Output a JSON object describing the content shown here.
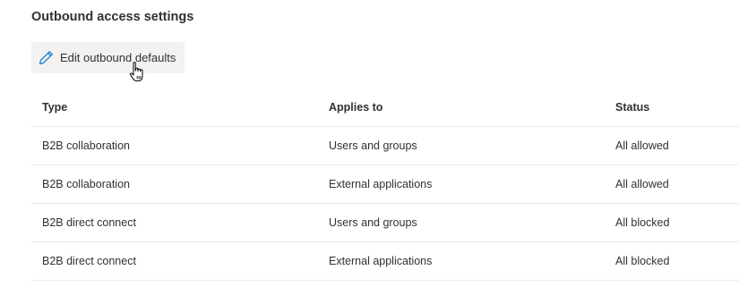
{
  "section": {
    "title": "Outbound access settings"
  },
  "toolbar": {
    "edit_label": "Edit outbound defaults",
    "edit_icon": "pencil-icon"
  },
  "table": {
    "columns": [
      "Type",
      "Applies to",
      "Status"
    ],
    "rows": [
      [
        "B2B collaboration",
        "Users and groups",
        "All allowed"
      ],
      [
        "B2B collaboration",
        "External applications",
        "All allowed"
      ],
      [
        "B2B direct connect",
        "Users and groups",
        "All blocked"
      ],
      [
        "B2B direct connect",
        "External applications",
        "All blocked"
      ]
    ]
  },
  "colors": {
    "accent": "#0078d4",
    "button_bg": "#f3f2f1",
    "text": "#323130",
    "divider": "#edebe9"
  }
}
